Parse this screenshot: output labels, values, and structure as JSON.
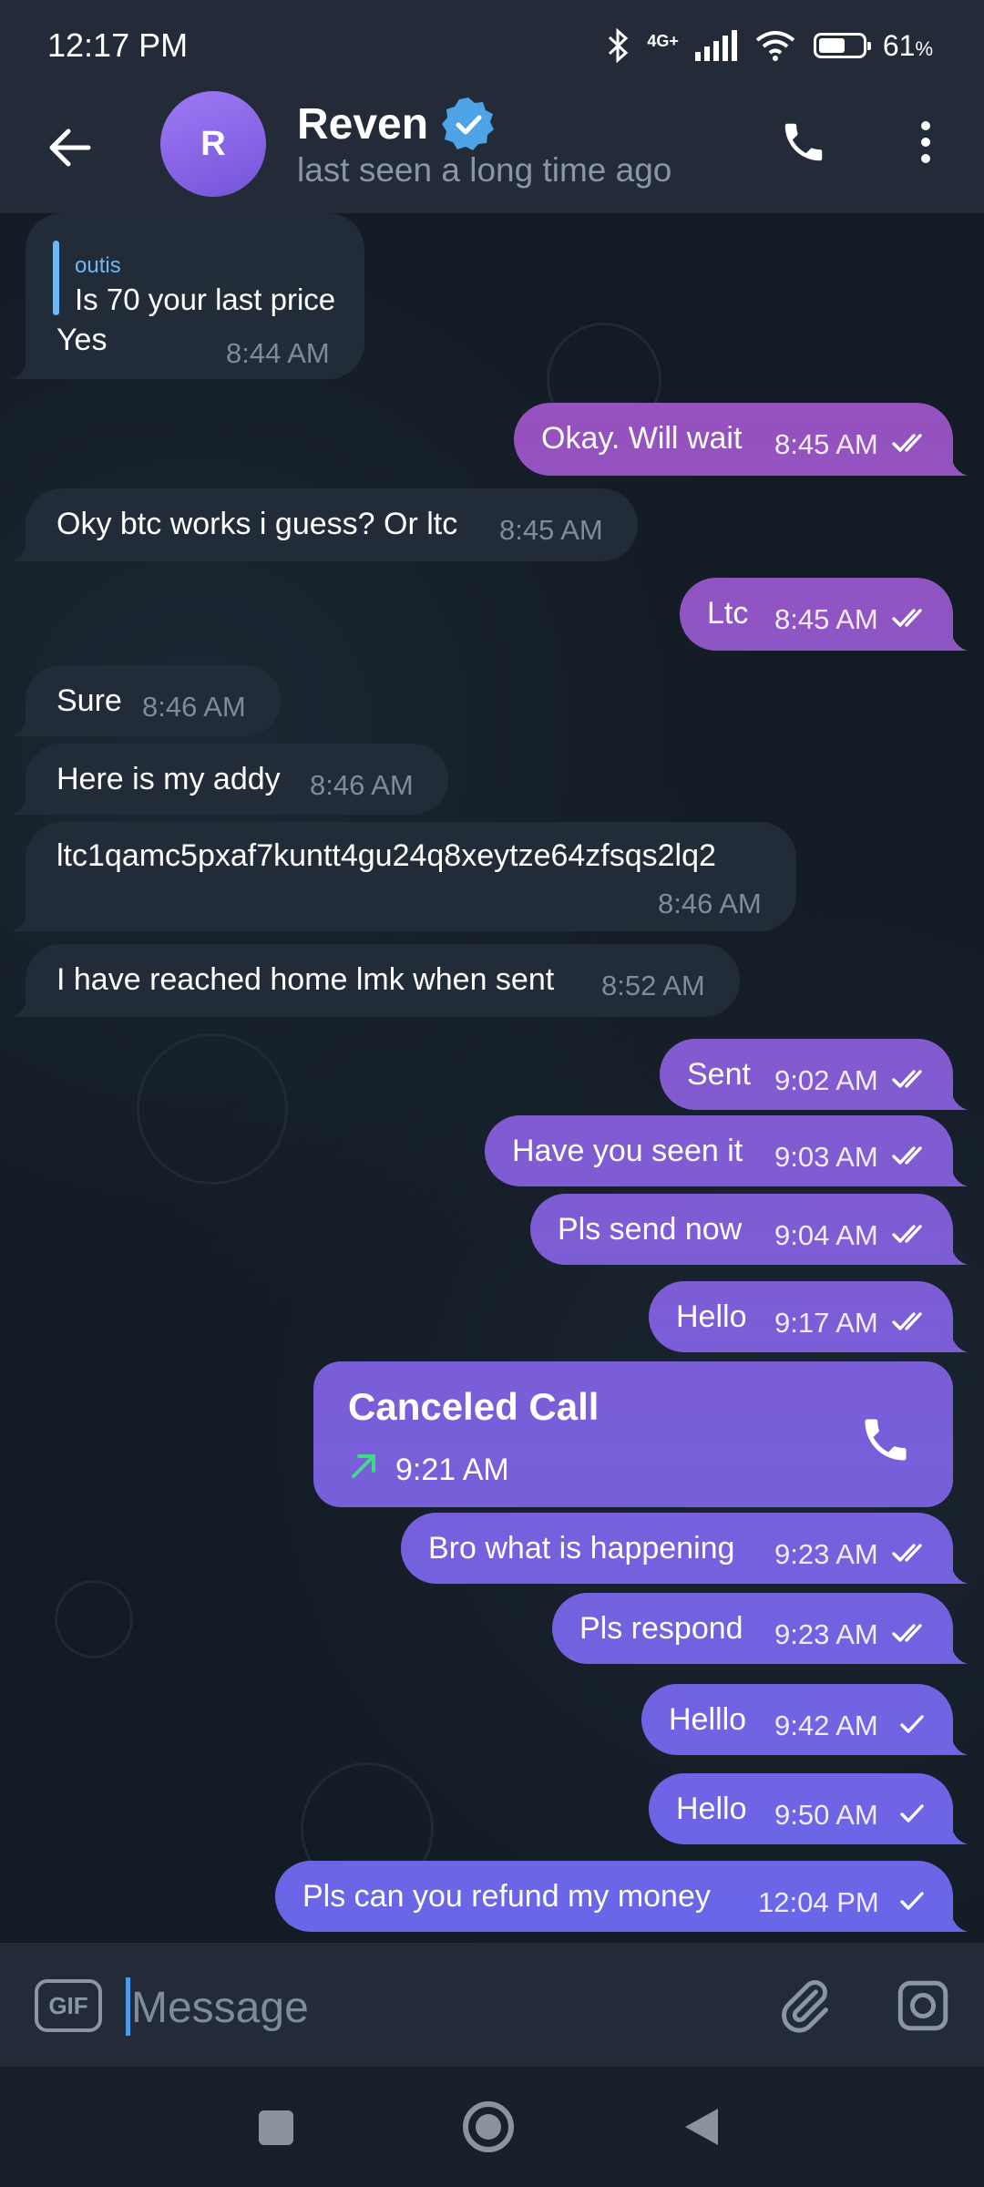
{
  "status": {
    "time": "12:17 PM",
    "network": "4G+",
    "battery": "61",
    "battery_unit": "%",
    "battery_level": 0.61
  },
  "header": {
    "avatar_letter": "R",
    "name": "Reven",
    "subtitle": "last seen a long time ago",
    "back_icon": "arrow-left-icon",
    "call_icon": "phone-icon",
    "menu_icon": "more-vertical-icon",
    "verified_icon": "verified-badge-icon"
  },
  "messages": [
    {
      "dir": "in",
      "reply_name": "outis",
      "reply_text": "Is 70 your last price",
      "text": "Yes",
      "time": "8:44 AM"
    },
    {
      "dir": "out",
      "text": "Okay. Will wait",
      "time": "8:45 AM",
      "status": "read"
    },
    {
      "dir": "in",
      "text": "Oky btc works i guess? Or ltc",
      "time": "8:45 AM"
    },
    {
      "dir": "out",
      "text": "Ltc",
      "time": "8:45 AM",
      "status": "read"
    },
    {
      "dir": "in",
      "text": "Sure",
      "time": "8:46 AM"
    },
    {
      "dir": "in",
      "text": "Here is my addy",
      "time": "8:46 AM"
    },
    {
      "dir": "in",
      "text": "ltc1qamc5pxaf7kuntt4gu24q8xeytze64zfsqs2lq2",
      "time": "8:46 AM"
    },
    {
      "dir": "in",
      "text": "I have reached home lmk when sent",
      "time": "8:52 AM"
    },
    {
      "dir": "out",
      "text": "Sent",
      "time": "9:02 AM",
      "status": "read"
    },
    {
      "dir": "out",
      "text": "Have you seen it",
      "time": "9:03 AM",
      "status": "read"
    },
    {
      "dir": "out",
      "text": "Pls send now",
      "time": "9:04 AM",
      "status": "read"
    },
    {
      "dir": "out",
      "text": "Hello",
      "time": "9:17 AM",
      "status": "read"
    },
    {
      "dir": "out",
      "type": "call",
      "title": "Canceled Call",
      "time": "9:21 AM"
    },
    {
      "dir": "out",
      "text": "Bro what is happening",
      "time": "9:23 AM",
      "status": "read"
    },
    {
      "dir": "out",
      "text": "Pls respond",
      "time": "9:23 AM",
      "status": "read"
    },
    {
      "dir": "out",
      "text": "Helllo",
      "time": "9:42 AM",
      "status": "sent"
    },
    {
      "dir": "out",
      "text": "Hello",
      "time": "9:50 AM",
      "status": "sent"
    },
    {
      "dir": "out",
      "text": "Pls can you refund my money",
      "time": "12:04 PM",
      "status": "sent"
    }
  ],
  "input": {
    "gif_label": "GIF",
    "placeholder": "Message",
    "attach_icon": "paperclip-icon",
    "camera_icon": "camera-icon"
  },
  "colors": {
    "background": "#131b24",
    "header": "#222b37",
    "incoming": "#222c38",
    "outgoing_top": "#9b4fb8",
    "outgoing_bottom": "#6a66e8",
    "accent": "#6fb6f5"
  }
}
